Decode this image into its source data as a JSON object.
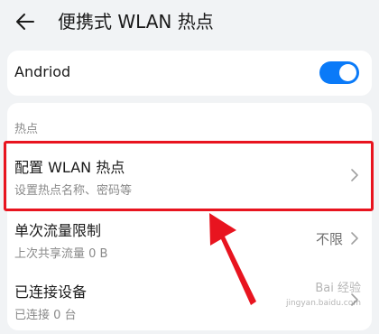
{
  "header": {
    "title": "便携式 WLAN 热点"
  },
  "hotspot_toggle": {
    "label": "Andriod",
    "state": "on",
    "color": "#0a7af8"
  },
  "section": {
    "title": "热点"
  },
  "rows": [
    {
      "label": "配置 WLAN 热点",
      "sub": "设置热点名称、密码等",
      "value": ""
    },
    {
      "label": "单次流量限制",
      "sub": "上次共享流量 0 B",
      "value": "不限"
    },
    {
      "label": "已连接设备",
      "sub": "已连接 0 台",
      "value": ""
    }
  ],
  "annotation": {
    "color": "#e8141f"
  },
  "watermark": {
    "text": "Bai 经验",
    "url": "jingyan.baidu.com"
  }
}
